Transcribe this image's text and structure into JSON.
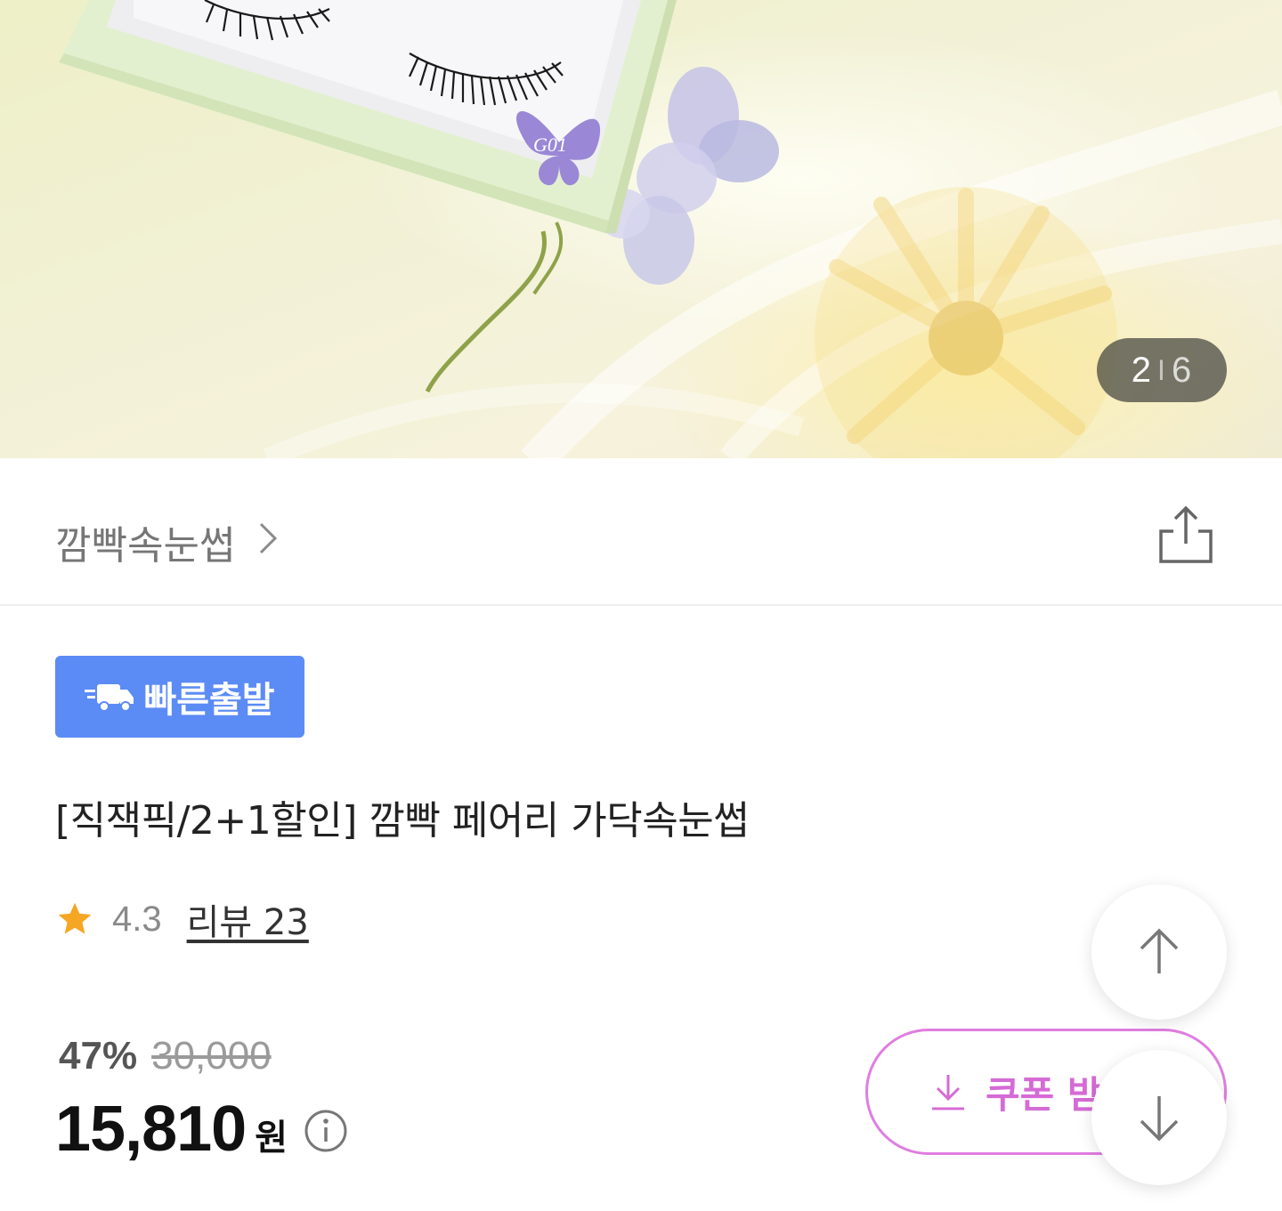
{
  "gallery": {
    "current": "2",
    "separator": "I",
    "total": "6",
    "box_label": "G01"
  },
  "brand": {
    "name": "깜빡속눈썹",
    "chevron_icon": "chevron-right-icon",
    "share_icon": "share-icon"
  },
  "badge": {
    "label": "빠른출발",
    "icon": "fast-delivery-truck-icon",
    "color": "#5b8bf5"
  },
  "product": {
    "title": "[직잭픽/2+1할인] 깜빡 페어리 가닥속눈썹",
    "rating": "4.3",
    "reviews_label": "리뷰 23",
    "star_color": "#f5a623"
  },
  "price": {
    "discount": "47%",
    "original": "30,000",
    "final": "15,810",
    "currency": "원",
    "info_icon": "info-icon"
  },
  "coupon": {
    "label": "쿠폰 받",
    "icon": "download-icon",
    "color": "#d56bd5"
  },
  "scroll": {
    "up_icon": "arrow-up-icon",
    "down_icon": "arrow-down-icon"
  }
}
